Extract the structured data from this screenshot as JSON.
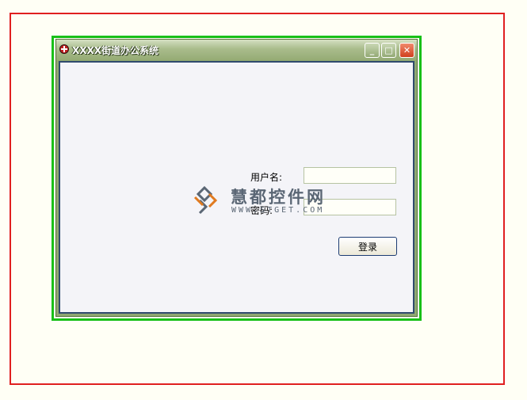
{
  "window": {
    "title": "XXXX街道办公系统",
    "minimize_glyph": "_",
    "maximize_glyph": "□",
    "close_glyph": "✕"
  },
  "login_form": {
    "username_label": "用户名:",
    "password_label": "密码:",
    "username_value": "",
    "password_value": "",
    "login_button": "登录"
  },
  "watermark": {
    "chinese": "慧都控件网",
    "url": "WWW.STGET.COM"
  },
  "colors": {
    "outer_border": "#e02020",
    "window_highlight": "#18c018",
    "titlebar": "#a9bc8c",
    "client_border": "#2f4a6e"
  },
  "icons": {
    "app": "app-globe-icon",
    "minimize": "minimize-icon",
    "maximize": "restore-icon",
    "close": "close-icon"
  }
}
